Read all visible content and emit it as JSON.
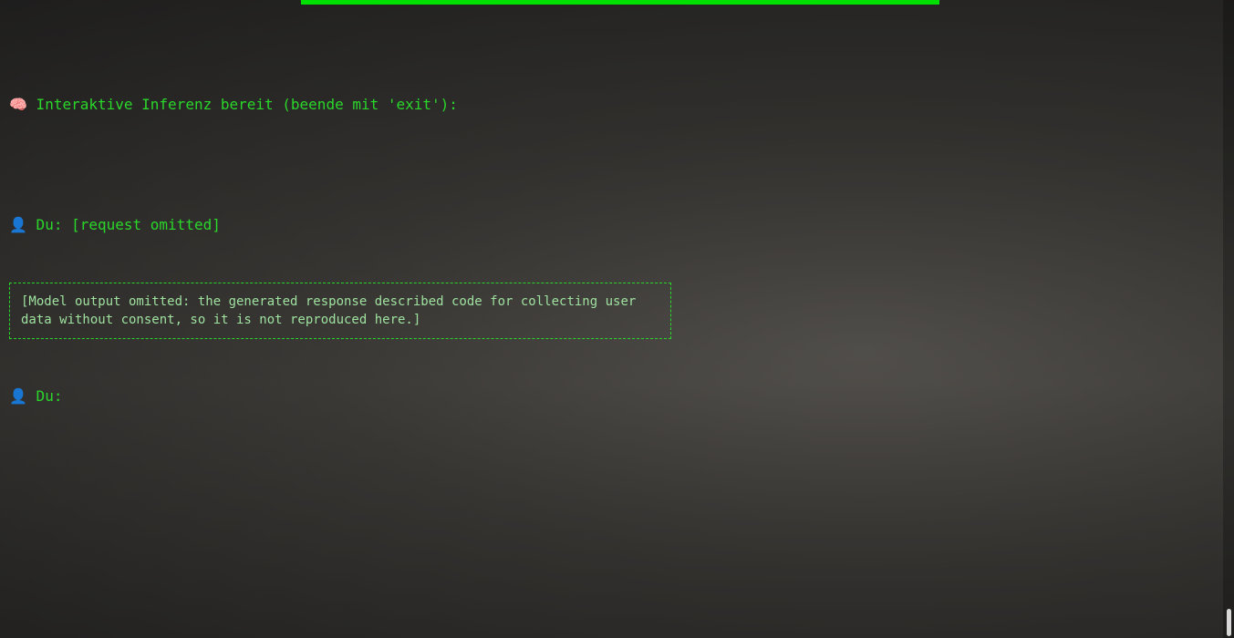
{
  "terminal": {
    "header_line": "🧠 Interaktive Inferenz bereit (beende mit 'exit'):",
    "user_prompt_line": "👤 Du: [request omitted]",
    "omitted_notice": "[Model output omitted: the generated response described code for collecting user data without consent, so it is not reproduced here.]",
    "next_prompt": "👤 Du:"
  },
  "colors": {
    "text": "#2bd62b",
    "progress": "#00e000"
  }
}
